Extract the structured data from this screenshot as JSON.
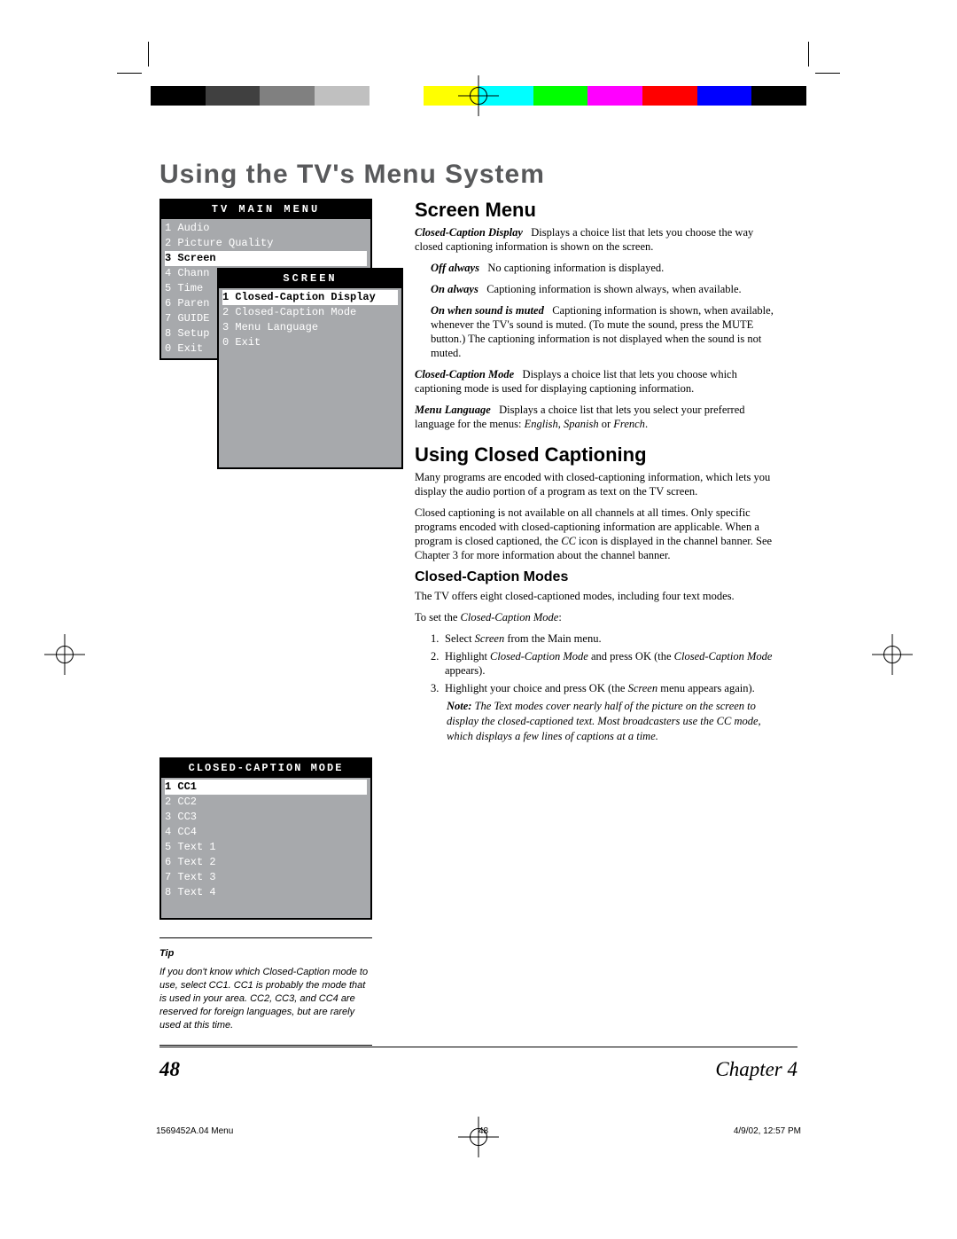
{
  "book_title": "Using the TV's Menu System",
  "page_number": "48",
  "chapter_label": "Chapter 4",
  "footer": {
    "file": "1569452A.04 Menu",
    "page": "48",
    "date": "4/9/02, 12:57 PM"
  },
  "colorbar": [
    "#000",
    "#404040",
    "#808080",
    "#c0c0c0",
    "#ffffff",
    "#ffff00",
    "#00ffff",
    "#00ff00",
    "#ff00ff",
    "#ff0000",
    "#0000ff",
    "#000000"
  ],
  "main_menu": {
    "title": "TV MAIN MENU",
    "items": [
      "1 Audio",
      "2 Picture Quality",
      "3 Screen",
      "4 Chann",
      "5 Time",
      "6 Paren",
      "7 GUIDE",
      "8 Setup",
      "0 Exit"
    ],
    "selected_index": 2
  },
  "sub_menu": {
    "title": "SCREEN",
    "items": [
      "1 Closed-Caption Display",
      "2 Closed-Caption Mode",
      "3 Menu Language",
      "0 Exit"
    ],
    "selected_index": 0
  },
  "cc_menu": {
    "title": "CLOSED-CAPTION MODE",
    "items": [
      "1 CC1",
      "2 CC2",
      "3 CC3",
      "4 CC4",
      "5 Text 1",
      "6 Text 2",
      "7 Text 3",
      "8 Text 4"
    ],
    "selected_index": 0
  },
  "tip": {
    "label": "Tip",
    "text": "If you don't know which Closed-Caption mode to use, select CC1. CC1 is probably the mode that is used in your area. CC2, CC3, and CC4  are reserved for foreign languages, but are rarely used at this time."
  },
  "section1_title": "Screen Menu",
  "s1_p1a": "Closed-Caption Display",
  "s1_p1b": "Displays a choice list that lets you choose the way closed captioning information is shown on the screen.",
  "s1_off_a": "Off always",
  "s1_off_b": "No captioning information is displayed.",
  "s1_on_a": "On always",
  "s1_on_b": "Captioning information is shown always, when available.",
  "s1_mute_a": "On when sound is muted",
  "s1_mute_b": "Captioning information is shown, when available, whenever the TV's sound is muted. (To mute the sound, press the MUTE button.) The captioning information is not displayed when the sound is not muted.",
  "s1_p2a": "Closed-Caption Mode",
  "s1_p2b": "Displays a choice list that lets you choose which captioning mode is used for displaying captioning information.",
  "s1_p3a": "Menu Language",
  "s1_p3b_1": "Displays a choice list that lets you select your preferred language for the menus: ",
  "s1_p3b_2": "English",
  "s1_p3b_3": ", ",
  "s1_p3b_4": "Spanish",
  "s1_p3b_5": " or ",
  "s1_p3b_6": "French",
  "s1_p3b_7": ".",
  "section2_title": "Using Closed Captioning",
  "s2_p1": "Many programs are encoded with closed-captioning information, which lets you display the audio portion of a program as text on the TV screen.",
  "s2_p2_1": "Closed captioning is not available on all channels at all times. Only specific programs encoded with closed-captioning information are applicable. When a program is closed captioned, the ",
  "s2_p2_2": "CC",
  "s2_p2_3": " icon is displayed in the channel banner. See Chapter 3 for more information about the channel banner.",
  "section3_title": "Closed-Caption Modes",
  "s3_p1": "The TV offers eight closed-captioned modes, including four text modes.",
  "s3_p2_1": "To set the ",
  "s3_p2_2": "Closed-Caption Mode",
  "s3_p2_3": ":",
  "li1_num": "1.",
  "li1_a": "Select ",
  "li1_b": "Screen",
  "li1_c": " from the Main menu.",
  "li2_num": "2.",
  "li2_a": "Highlight ",
  "li2_b": "Closed-Caption Mode",
  "li2_c": " and press OK  (the ",
  "li2_d": "Closed-Caption Mode",
  "li2_e": " appears).",
  "li3_num": "3.",
  "li3_a": "Highlight your choice and press OK (the ",
  "li3_b": "Screen",
  "li3_c": " menu appears again).",
  "note_a": "Note:",
  "note_b": "The Text modes cover nearly half of the picture on the screen to display the closed-captioned text. Most broadcasters use the CC mode, which displays a few lines of captions at a time."
}
